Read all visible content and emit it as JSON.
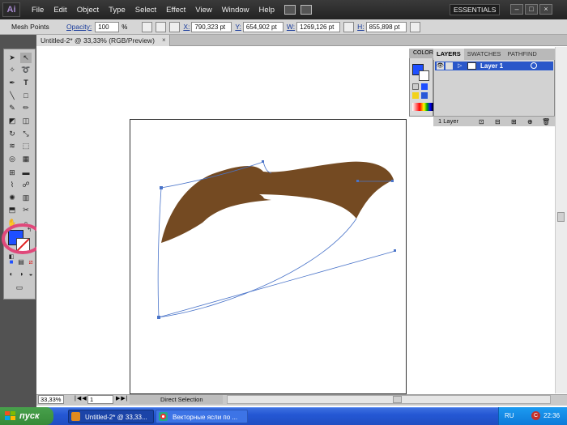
{
  "menubar": {
    "logo": "Ai",
    "items": [
      "File",
      "Edit",
      "Object",
      "Type",
      "Select",
      "Effect",
      "View",
      "Window",
      "Help"
    ],
    "workspace": "ESSENTIALS"
  },
  "control": {
    "tool_name": "Mesh Points",
    "opacity_label": "Opacity:",
    "opacity_value": "100",
    "opacity_unit": "%",
    "x_label": "X:",
    "x_value": "790,323 pt",
    "y_label": "Y:",
    "y_value": "654,902 pt",
    "w_label": "W:",
    "w_value": "1269,126 pt",
    "h_label": "H:",
    "h_value": "855,898 pt"
  },
  "document": {
    "tab_title": "Untitled-2* @ 33,33% (RGB/Preview)",
    "close": "×"
  },
  "panels": {
    "color_tab": "COLOR",
    "layers_tabs": [
      "LAYERS",
      "SWATCHES",
      "PATHFIND"
    ],
    "layer_name": "Layer 1",
    "layer_count": "1 Layer"
  },
  "status": {
    "zoom": "33,33%",
    "page": "1",
    "tool": "Direct Selection"
  },
  "taskbar": {
    "start": "пуск",
    "task1": "Untitled-2* @ 33,33...",
    "task2": "Векторные ясли по ...",
    "lang": "RU",
    "tray_icon": "C",
    "time": "22:36"
  },
  "colors": {
    "shape_fill": "#744a22",
    "fill_swatch": "#1e4fff",
    "highlight": "#e0487a",
    "path_stroke": "#4a74c9"
  }
}
